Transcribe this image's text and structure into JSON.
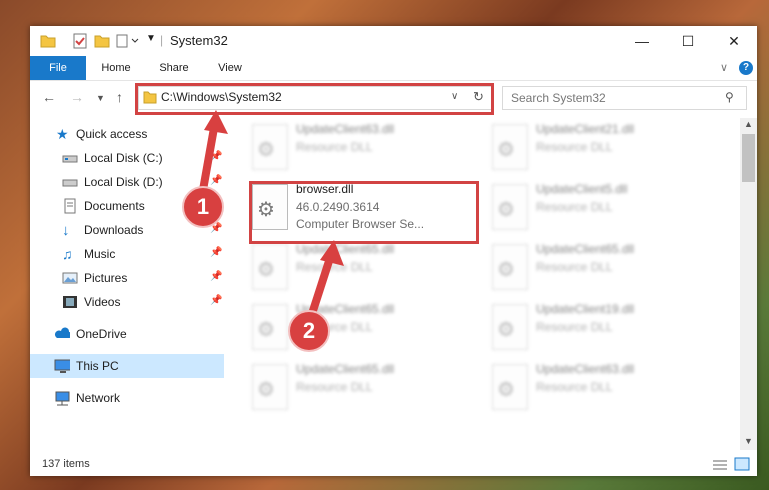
{
  "window": {
    "title": "System32"
  },
  "ribbon": {
    "tabs": [
      "File",
      "Home",
      "Share",
      "View"
    ]
  },
  "address": {
    "path": "C:\\Windows\\System32"
  },
  "search": {
    "placeholder": "Search System32"
  },
  "sidebar": {
    "items": [
      {
        "label": "Quick access",
        "icon": "star-icon",
        "pinned": false
      },
      {
        "label": "Local Disk (C:)",
        "icon": "drive-icon",
        "pinned": true
      },
      {
        "label": "Local Disk (D:)",
        "icon": "drive-icon",
        "pinned": true
      },
      {
        "label": "Documents",
        "icon": "documents-icon",
        "pinned": true
      },
      {
        "label": "Downloads",
        "icon": "download-icon",
        "pinned": true
      },
      {
        "label": "Music",
        "icon": "music-icon",
        "pinned": true
      },
      {
        "label": "Pictures",
        "icon": "pictures-icon",
        "pinned": true
      },
      {
        "label": "Videos",
        "icon": "videos-icon",
        "pinned": true
      },
      {
        "label": "OneDrive",
        "icon": "cloud-icon",
        "pinned": false
      },
      {
        "label": "This PC",
        "icon": "computer-icon",
        "pinned": false,
        "selected": true
      },
      {
        "label": "Network",
        "icon": "network-icon",
        "pinned": false
      }
    ]
  },
  "files": [
    {
      "name": "UpdateClient63.dll",
      "line2": "Resource DLL",
      "line3": "",
      "blurred": true
    },
    {
      "name": "UpdateClient21.dll",
      "line2": "Resource DLL",
      "line3": "",
      "blurred": true
    },
    {
      "name": "browser.dll",
      "line2": "46.0.2490.3614",
      "line3": "Computer Browser Se...",
      "blurred": false
    },
    {
      "name": "UpdateClient5.dll",
      "line2": "Resource DLL",
      "line3": "",
      "blurred": true
    },
    {
      "name": "UpdateClient65.dll",
      "line2": "Resource DLL",
      "line3": "",
      "blurred": true
    },
    {
      "name": "UpdateClient65.dll",
      "line2": "Resource DLL",
      "line3": "",
      "blurred": true
    },
    {
      "name": "UpdateClient65.dll",
      "line2": "Resource DLL",
      "line3": "",
      "blurred": true
    },
    {
      "name": "UpdateClient19.dll",
      "line2": "Resource DLL",
      "line3": "",
      "blurred": true
    },
    {
      "name": "UpdateClient65.dll",
      "line2": "Resource DLL",
      "line3": "",
      "blurred": true
    },
    {
      "name": "UpdateClient63.dll",
      "line2": "Resource DLL",
      "line3": "",
      "blurred": true
    }
  ],
  "status": {
    "item_count": "137 items"
  },
  "annotations": {
    "badge1": "1",
    "badge2": "2",
    "color": "#d84040"
  }
}
